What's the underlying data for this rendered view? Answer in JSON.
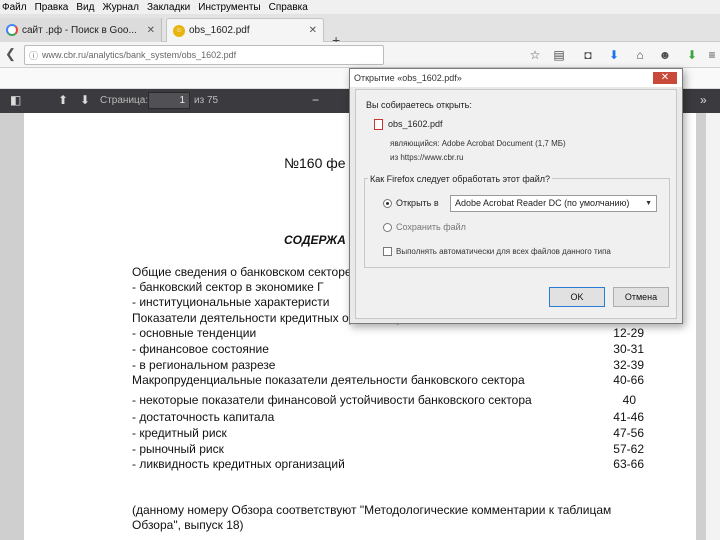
{
  "menubar": {
    "items": [
      "Файл",
      "Правка",
      "Вид",
      "Журнал",
      "Закладки",
      "Инструменты",
      "Справка"
    ]
  },
  "tabs": [
    {
      "title": "сайт .рф - Поиск в Goo...",
      "active": false
    },
    {
      "title": "obs_1602.pdf",
      "active": true
    }
  ],
  "address": {
    "url": "www.cbr.ru/analytics/bank_system/obs_1602.pdf"
  },
  "pdf_toolbar": {
    "page_label": "Страница:",
    "page_value": "1",
    "of_pages": "из 75"
  },
  "document": {
    "title": "№160 фе",
    "subtitle": "СОДЕРЖА",
    "lines": [
      {
        "text": "Общие сведения о банковском секторе",
        "num": ""
      },
      {
        "text": "-   банковский сектор в экономике Г",
        "num": ""
      },
      {
        "text": "-   институциональные характеристи",
        "num": ""
      },
      {
        "text": "Показатели деятельности кредитных организаций",
        "num": ""
      },
      {
        "text": "-   основные тенденции",
        "num": "12-29"
      },
      {
        "text": "-   финансовое состояние",
        "num": "30-31"
      },
      {
        "text": "-   в региональном разрезе",
        "num": "32-39"
      },
      {
        "text": "Макропруденциальные показатели деятельности банковского сектора",
        "num": "40-66"
      },
      {
        "text": "-   некоторые показатели финансовой устойчивости банковского сектора",
        "num": "40"
      },
      {
        "text": "-   достаточность капитала",
        "num": "41-46"
      },
      {
        "text": "-   кредитный риск",
        "num": "47-56"
      },
      {
        "text": "-   рыночный риск",
        "num": "57-62"
      },
      {
        "text": "-   ликвидность кредитных организаций",
        "num": "63-66"
      }
    ],
    "footnote_1": "(данному номеру Обзора соответствуют \"Методологические комментарии к таблицам",
    "footnote_2": "Обзора\", выпуск 18)"
  },
  "dialog": {
    "title": "Открытие «obs_1602.pdf»",
    "intro": "Вы собираетесь открыть:",
    "filename": "obs_1602.pdf",
    "type_line": "являющийся:  Adobe Acrobat Document (1,7 МБ)",
    "source_line": "из https://www.cbr.ru",
    "question": "Как Firefox следует обработать этот файл?",
    "open_with_label": "Открыть в",
    "open_with_value": "Adobe Acrobat Reader DC  (по умолчанию)",
    "save_label": "Сохранить файл",
    "auto_label": "Выполнять автоматически для всех файлов данного типа",
    "ok_label": "OK",
    "cancel_label": "Отмена"
  },
  "colors": {
    "pdf_toolbar": "#3b3b3f",
    "dialog_close": "#c94a3a",
    "ok_border": "#2a7ad6"
  }
}
